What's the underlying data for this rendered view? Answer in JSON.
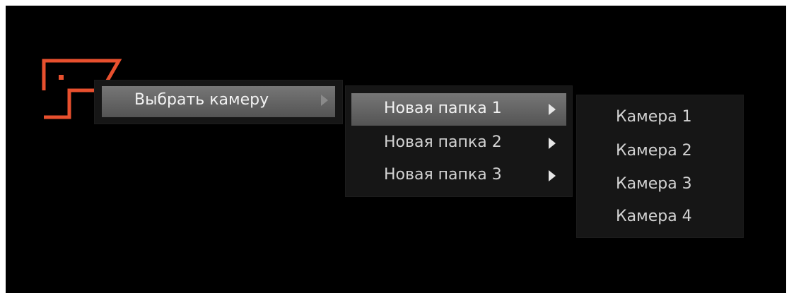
{
  "icon": {
    "name": "camera-icon",
    "color": "#e8502e"
  },
  "menu": {
    "main_item": {
      "label": "Выбрать камеру"
    },
    "folders": [
      {
        "label": "Новая папка 1",
        "active": true
      },
      {
        "label": "Новая папка 2",
        "active": false
      },
      {
        "label": "Новая папка 3",
        "active": false
      }
    ],
    "cameras": [
      {
        "label": "Камера 1"
      },
      {
        "label": "Камера 2"
      },
      {
        "label": "Камера 3"
      },
      {
        "label": "Камера 4"
      }
    ]
  },
  "colors": {
    "background": "#000000",
    "menu_bg": "#161616",
    "highlight": "#6a6a6a",
    "text": "#d2d2d2"
  }
}
